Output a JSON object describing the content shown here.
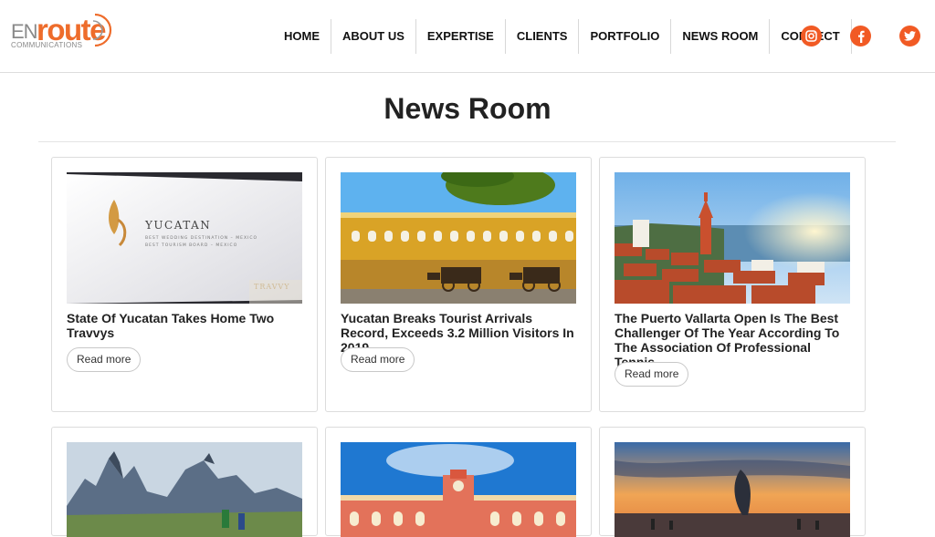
{
  "brand": {
    "logo_en": "EN",
    "logo_route": "route",
    "logo_sub": "COMMUNICATIONS"
  },
  "nav": {
    "items": [
      "HOME",
      "ABOUT US",
      "EXPERTISE",
      "CLIENTS",
      "PORTFOLIO",
      "NEWS ROOM",
      "CONNECT"
    ]
  },
  "social": [
    "instagram-icon",
    "facebook-icon",
    "twitter-icon"
  ],
  "colors": {
    "accent": "#f15a24",
    "text": "#222222",
    "border": "#dcdcdc"
  },
  "page": {
    "title": "News Room"
  },
  "articles": [
    {
      "title": "State Of Yucatan Takes Home Two Travvys",
      "read_more": "Read more"
    },
    {
      "title": "Yucatan Breaks Tourist Arrivals Record, Exceeds 3.2 Million Visitors In 2019",
      "read_more": "Read more"
    },
    {
      "title": "The Puerto Vallarta Open Is The Best Challenger Of The Year According To The Association Of Professional Tennis",
      "read_more": "Read more"
    }
  ],
  "img_text": {
    "yucatan": "YUCATAN",
    "line1": "BEST WEDDING DESTINATION – MEXICO",
    "line2": "BEST TOURISM BOARD – MEXICO",
    "travvy": "TRAVVY"
  }
}
